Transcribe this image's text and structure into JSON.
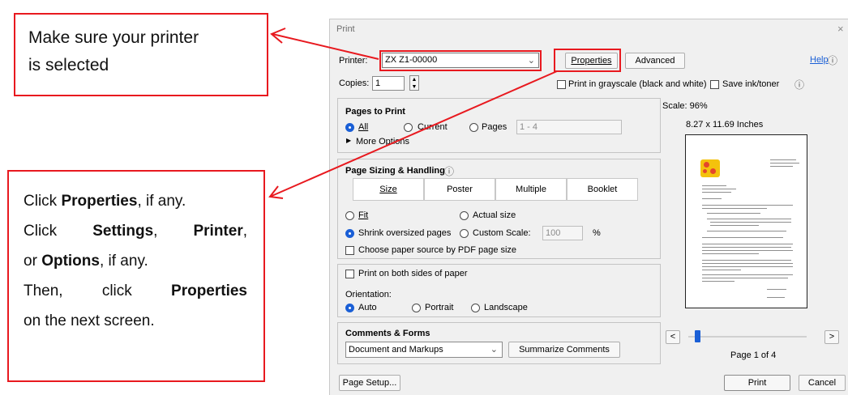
{
  "callouts": {
    "printer": {
      "line1": "Make sure your printer",
      "line2": "is selected"
    },
    "properties": {
      "l1_a": "Click ",
      "l1_b": "Properties",
      "l1_c": ", if any.",
      "l2_a": "Click",
      "l2_b": "Settings",
      "l2_c": ",",
      "l2_d": "Printer",
      "l2_e": ",",
      "l3_a": "or ",
      "l3_b": "Options",
      "l3_c": ", if any.",
      "l4_a": "Then,",
      "l4_b": "click",
      "l4_c": "Properties",
      "l5": "on the next screen."
    }
  },
  "dialog": {
    "title": "Print",
    "close_glyph": "×",
    "printer_label": "Printer:",
    "printer_value": "ZX Z1-00000",
    "properties_label": "Properties",
    "advanced_label": "Advanced",
    "help_label": "Help",
    "help_glyph": "ⓘ",
    "copies_label": "Copies:",
    "copies_value": "1",
    "grayscale_label": "Print in grayscale (black and white)",
    "save_ink_label": "Save ink/toner",
    "info_glyph": "ⓘ",
    "pages": {
      "title": "Pages to Print",
      "all": "All",
      "current": "Current",
      "pages": "Pages",
      "range_value": "1 - 4",
      "more_options": "More Options"
    },
    "sizing": {
      "title": "Page Sizing & Handling",
      "tabs": [
        "Size",
        "Poster",
        "Multiple",
        "Booklet"
      ],
      "fit": "Fit",
      "actual_size": "Actual size",
      "shrink": "Shrink oversized pages",
      "custom_scale": "Custom Scale:",
      "custom_scale_value": "100",
      "percent": "%",
      "paper_source": "Choose paper source by PDF page size"
    },
    "both_sides_label": "Print on both sides of paper",
    "orientation": {
      "title": "Orientation:",
      "auto": "Auto",
      "portrait": "Portrait",
      "landscape": "Landscape"
    },
    "comments": {
      "title": "Comments & Forms",
      "value": "Document and Markups",
      "summarize": "Summarize Comments"
    },
    "preview": {
      "scale": "Scale: 96%",
      "size": "8.27 x 11.69 Inches",
      "page_of": "Page 1 of 4",
      "prev": "<",
      "next": ">"
    },
    "page_setup_label": "Page Setup...",
    "print_label": "Print",
    "cancel_label": "Cancel"
  },
  "colors": {
    "callout_red": "#e8191f",
    "accent_blue": "#1a5fd6"
  }
}
